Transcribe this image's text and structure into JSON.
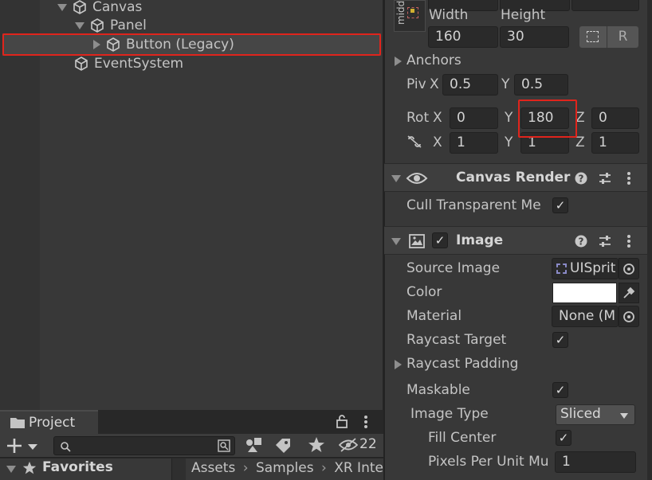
{
  "hierarchy": {
    "items": [
      {
        "label": "Canvas",
        "expanded": true
      },
      {
        "label": "Panel",
        "expanded": true
      },
      {
        "label": "Button (Legacy)",
        "expanded": false,
        "selected": true
      },
      {
        "label": "EventSystem"
      }
    ]
  },
  "rect_transform": {
    "anchor_preset_label": "midd",
    "width_label": "Width",
    "height_label": "Height",
    "width": "160",
    "height": "30",
    "blueprint_button": "R",
    "anchors_label": "Anchors",
    "pivot_label": "Piv",
    "pivot_x_label": "X",
    "pivot_x": "0.5",
    "pivot_y_label": "Y",
    "pivot_y": "0.5",
    "rotation_label": "Rot",
    "rot_x_label": "X",
    "rot_x": "0",
    "rot_y_label": "Y",
    "rot_y": "180",
    "rot_z_label": "Z",
    "rot_z": "0",
    "scale_x_label": "X",
    "scale_x": "1",
    "scale_y_label": "Y",
    "scale_y": "1",
    "scale_z_label": "Z",
    "scale_z": "1"
  },
  "canvas_renderer": {
    "title": "Canvas Render",
    "cull_label": "Cull Transparent Me",
    "cull_checked": "✓"
  },
  "image": {
    "title": "Image",
    "enabled": "✓",
    "source_image_label": "Source Image",
    "source_image_value": "UISprit",
    "color_label": "Color",
    "color_value": "#ffffff",
    "material_label": "Material",
    "material_value": "None (M",
    "raycast_target_label": "Raycast Target",
    "raycast_target_checked": "✓",
    "raycast_padding_label": "Raycast Padding",
    "maskable_label": "Maskable",
    "maskable_checked": "✓",
    "image_type_label": "Image Type",
    "image_type_value": "Sliced",
    "fill_center_label": "Fill Center",
    "fill_center_checked": "✓",
    "ppu_label": "Pixels Per Unit Mu",
    "ppu_value": "1"
  },
  "project": {
    "tab_label": "Project",
    "search_placeholder": "",
    "hidden_count": "22",
    "favorites_label": "Favorites",
    "breadcrumb": [
      "Assets",
      "Samples",
      "XR Inte"
    ]
  },
  "colors": {
    "highlight": "#e0241c",
    "panel_bg": "#383838",
    "field_bg": "#2a2a2a"
  }
}
